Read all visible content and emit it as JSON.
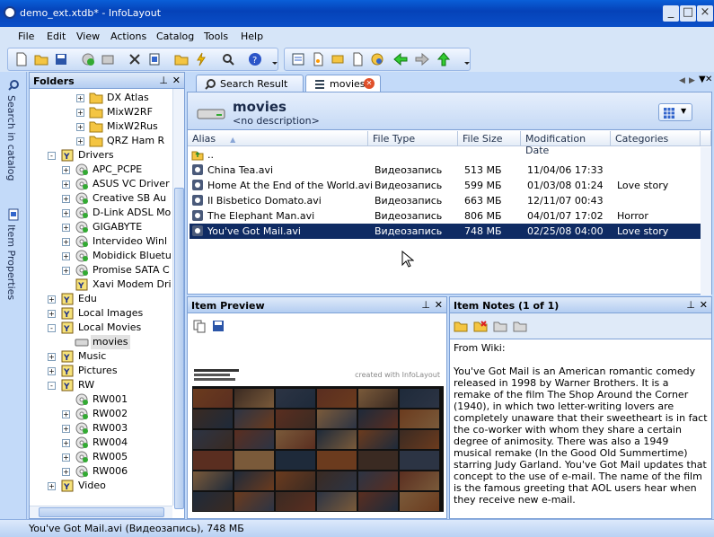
{
  "window": {
    "title": "demo_ext.xtdb* - InfoLayout",
    "minimize": "_",
    "maximize": "□",
    "close": "×"
  },
  "menu": [
    "File",
    "Edit",
    "View",
    "Actions",
    "Catalog",
    "Tools",
    "Help"
  ],
  "side_tabs": {
    "search": "Search in catalog",
    "properties": "Item Properties"
  },
  "folders": {
    "title": "Folders",
    "items": [
      {
        "label": "DX Atlas",
        "level": 3,
        "exp": "+",
        "icon": "folder"
      },
      {
        "label": "MixW2RF",
        "level": 3,
        "exp": "+",
        "icon": "folder"
      },
      {
        "label": "MixW2Rus",
        "level": 3,
        "exp": "+",
        "icon": "folder"
      },
      {
        "label": "QRZ Ham R",
        "level": 3,
        "exp": "+",
        "icon": "folder"
      },
      {
        "label": "Drivers",
        "level": 1,
        "exp": "-",
        "icon": "catalog"
      },
      {
        "label": "APC_PCPE",
        "level": 2,
        "exp": "+",
        "icon": "disk"
      },
      {
        "label": "ASUS VC Driver",
        "level": 2,
        "exp": "+",
        "icon": "disk"
      },
      {
        "label": "Creative SB Au",
        "level": 2,
        "exp": "+",
        "icon": "disk"
      },
      {
        "label": "D-Link ADSL Mo",
        "level": 2,
        "exp": "+",
        "icon": "disk"
      },
      {
        "label": "GIGABYTE",
        "level": 2,
        "exp": "+",
        "icon": "disk"
      },
      {
        "label": "Intervideo Winl",
        "level": 2,
        "exp": "+",
        "icon": "disk"
      },
      {
        "label": "Mobidick Bluetu",
        "level": 2,
        "exp": "+",
        "icon": "disk"
      },
      {
        "label": "Promise SATA C",
        "level": 2,
        "exp": "+",
        "icon": "disk"
      },
      {
        "label": "Xavi Modem Dri",
        "level": 2,
        "exp": "",
        "icon": "catalog"
      },
      {
        "label": "Edu",
        "level": 1,
        "exp": "+",
        "icon": "catalog"
      },
      {
        "label": "Local Images",
        "level": 1,
        "exp": "+",
        "icon": "catalog"
      },
      {
        "label": "Local Movies",
        "level": 1,
        "exp": "-",
        "icon": "catalog"
      },
      {
        "label": "movies",
        "level": 2,
        "exp": "",
        "icon": "drive",
        "selected": true
      },
      {
        "label": "Music",
        "level": 1,
        "exp": "+",
        "icon": "catalog"
      },
      {
        "label": "Pictures",
        "level": 1,
        "exp": "+",
        "icon": "catalog"
      },
      {
        "label": "RW",
        "level": 1,
        "exp": "-",
        "icon": "catalog"
      },
      {
        "label": "RW001",
        "level": 2,
        "exp": "",
        "icon": "disk"
      },
      {
        "label": "RW002",
        "level": 2,
        "exp": "+",
        "icon": "disk"
      },
      {
        "label": "RW003",
        "level": 2,
        "exp": "+",
        "icon": "disk"
      },
      {
        "label": "RW004",
        "level": 2,
        "exp": "+",
        "icon": "disk"
      },
      {
        "label": "RW005",
        "level": 2,
        "exp": "+",
        "icon": "disk"
      },
      {
        "label": "RW006",
        "level": 2,
        "exp": "+",
        "icon": "disk"
      },
      {
        "label": "Video",
        "level": 1,
        "exp": "+",
        "icon": "catalog"
      }
    ]
  },
  "tabs": [
    {
      "label": "Search Result"
    },
    {
      "label": "movies"
    }
  ],
  "list": {
    "header_title": "movies",
    "header_desc": "<no description>",
    "columns": [
      "Alias",
      "File Type",
      "File Size",
      "Modification Date",
      "Categories"
    ],
    "parent": "..",
    "rows": [
      {
        "alias": "China Tea.avi",
        "type": "Видеозапись",
        "size": "513 МБ",
        "date": "11/04/06 17:33",
        "cat": ""
      },
      {
        "alias": "Home At the End of the World.avi",
        "type": "Видеозапись",
        "size": "599 МБ",
        "date": "01/03/08 01:24",
        "cat": "Love story"
      },
      {
        "alias": "Il Bisbetico Domato.avi",
        "type": "Видеозапись",
        "size": "663 МБ",
        "date": "12/11/07 00:43",
        "cat": ""
      },
      {
        "alias": "The Elephant Man.avi",
        "type": "Видеозапись",
        "size": "806 МБ",
        "date": "04/01/07 17:02",
        "cat": "Horror"
      },
      {
        "alias": "You've Got Mail.avi",
        "type": "Видеозапись",
        "size": "748 МБ",
        "date": "02/25/08 04:00",
        "cat": "Love story",
        "selected": true
      }
    ]
  },
  "preview": {
    "title": "Item Preview",
    "watermark": "created with InfoLayout"
  },
  "notes": {
    "title": "Item Notes (1 of 1)",
    "text": "From Wiki:\n\nYou've Got Mail is an American romantic comedy released in 1998 by Warner Brothers. It is a remake of the film The Shop Around the Corner (1940), in which two letter-writing lovers are completely unaware that their sweetheart is in fact the co-worker with whom they share a certain degree of animosity. There was also a 1949 musical remake (In the Good Old Summertime) starring Judy Garland. You've Got Mail updates that concept to the use of e-mail. The name of the film is the famous greeting that AOL users hear when they receive new e-mail."
  },
  "status": "You've Got Mail.avi (Видеозапись), 748 МБ",
  "colors": {
    "selection": "#0f2b63",
    "frame": "#c3daf9",
    "titlebar": "#0542b8"
  }
}
